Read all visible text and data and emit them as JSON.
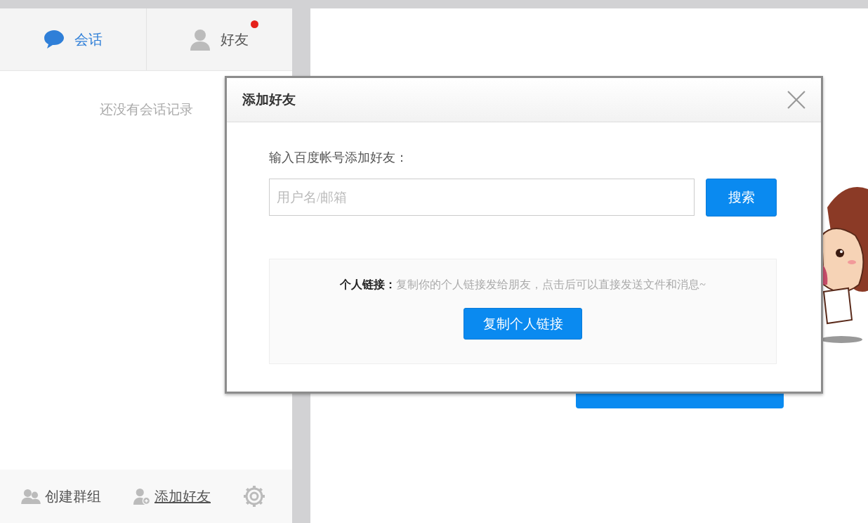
{
  "tabs": [
    {
      "label": "会话",
      "kind": "chat",
      "selected": true,
      "has_badge": false
    },
    {
      "label": "好友",
      "kind": "person",
      "selected": false,
      "has_badge": true
    }
  ],
  "conversation_list": {
    "empty_text": "还没有会话记录"
  },
  "bottom_bar": {
    "items": [
      {
        "label": "创建群组",
        "kind": "group",
        "underlined": false
      },
      {
        "label": "添加好友",
        "kind": "add-person",
        "underlined": true
      }
    ]
  },
  "dialog": {
    "title": "添加好友",
    "prompt": "输入百度帐号添加好友：",
    "search_field": {
      "placeholder": "用户名/邮箱"
    },
    "search_button": "搜索",
    "personal_link": {
      "label": "个人链接：",
      "description": "复制你的个人链接发给朋友，点击后可以直接发送文件和消息~",
      "button": "复制个人链接"
    }
  }
}
